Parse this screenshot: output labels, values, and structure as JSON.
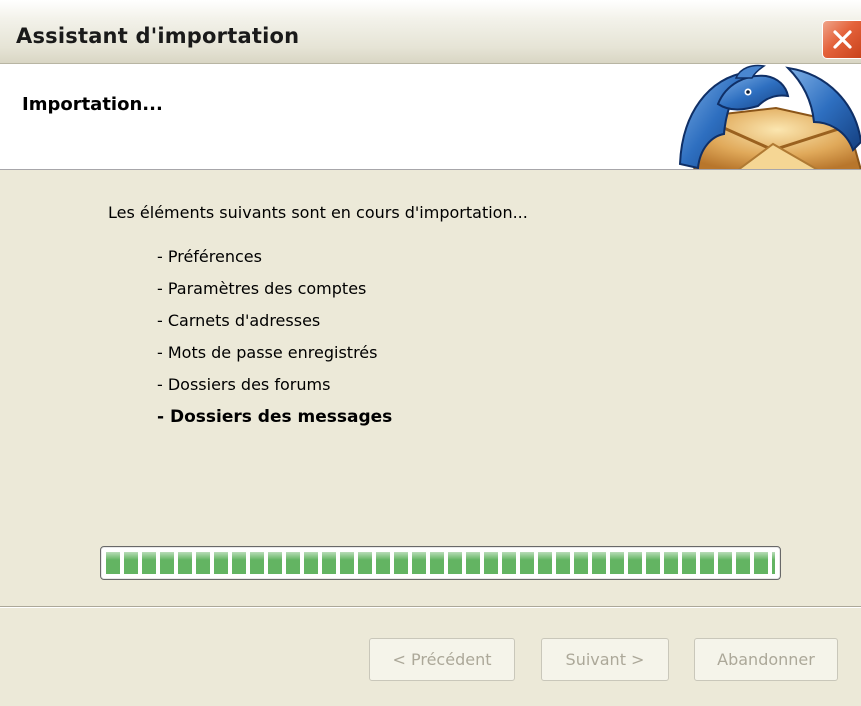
{
  "window": {
    "title": "Assistant d'importation"
  },
  "header": {
    "title": "Importation..."
  },
  "body": {
    "intro": "Les éléments suivants sont en cours d'importation...",
    "items": [
      "- Préférences",
      "- Paramètres des comptes",
      "- Carnets d'adresses",
      "- Mots de passe enregistrés",
      "- Dossiers des forums",
      "- Dossiers des messages"
    ],
    "active_item": "- Dossiers des messages"
  },
  "progress": {
    "value_percent": 100,
    "color": "#63b462"
  },
  "buttons": {
    "previous_label": "< Précédent",
    "next_label": "Suivant >",
    "cancel_label": "Abandonner",
    "disabled_color": "#aca899"
  },
  "icons": {
    "close": "close-icon",
    "logo": "thunderbird-logo"
  },
  "colors": {
    "close_button": "#e4623b",
    "window_background": "#ece9d8"
  }
}
